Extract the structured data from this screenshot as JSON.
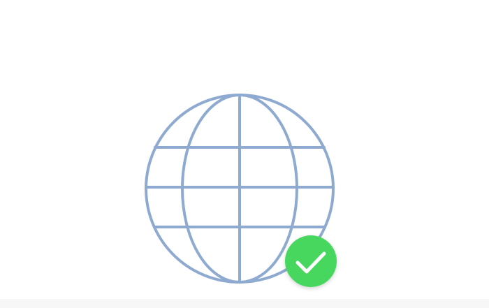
{
  "illustration": {
    "globe_icon": "globe-icon",
    "badge_icon": "checkmark-badge-icon",
    "colors": {
      "globe_stroke": "#8eaad0",
      "badge_fill": "#46d75f",
      "badge_check": "#ffffff",
      "background": "#ffffff",
      "bottom_band": "#f7f7f7"
    }
  }
}
